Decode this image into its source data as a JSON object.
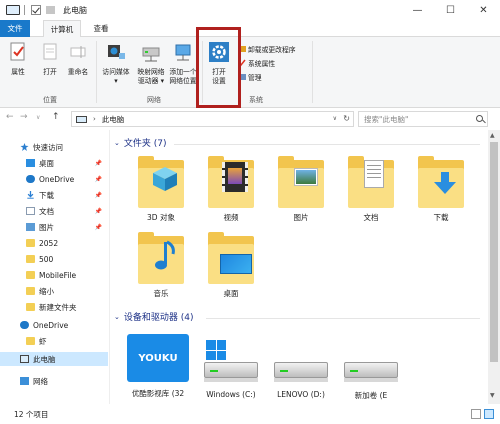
{
  "window": {
    "title": "此电脑",
    "min_label": "—",
    "max_label": "☐",
    "close_label": "✕"
  },
  "tabs": {
    "file": "文件",
    "computer": "计算机",
    "view": "查看"
  },
  "ribbon": {
    "location_group": {
      "label": "位置",
      "properties": "属性",
      "open": "打开",
      "rename": "重命名"
    },
    "network_group": {
      "label": "网络",
      "access_media_l1": "访问媒体",
      "access_media_l2": "▾",
      "map_drive_l1": "映射网络",
      "map_drive_l2": "驱动器 ▾",
      "add_location_l1": "添加一个",
      "add_location_l2": "网络位置"
    },
    "system_group": {
      "label": "系统",
      "open_settings_l1": "打开",
      "open_settings_l2": "设置",
      "uninstall": "卸载或更改程序",
      "system_properties": "系统属性",
      "manage": "管理"
    }
  },
  "navbar": {
    "back": "←",
    "forward": "→",
    "dropdown": "∨",
    "up": "↑",
    "path_sep": "›",
    "path": "此电脑",
    "search_placeholder": "搜索\"此电脑\""
  },
  "sidebar": {
    "items": [
      {
        "label": "快速访问",
        "icon": "star-icon"
      },
      {
        "label": "桌面",
        "icon": "desktop-icon",
        "pinned": true
      },
      {
        "label": "OneDrive",
        "icon": "cloud-icon",
        "pinned": true
      },
      {
        "label": "下载",
        "icon": "download-icon",
        "pinned": true
      },
      {
        "label": "文档",
        "icon": "document-icon",
        "pinned": true
      },
      {
        "label": "图片",
        "icon": "picture-icon",
        "pinned": true
      },
      {
        "label": "2052",
        "icon": "folder-icon"
      },
      {
        "label": "500",
        "icon": "folder-icon"
      },
      {
        "label": "MobileFile",
        "icon": "folder-icon"
      },
      {
        "label": "缩小",
        "icon": "folder-icon"
      },
      {
        "label": "新建文件夹",
        "icon": "folder-icon"
      },
      {
        "label": "OneDrive",
        "icon": "cloud-icon"
      },
      {
        "label": "虾",
        "icon": "folder-icon"
      },
      {
        "label": "此电脑",
        "icon": "computer-icon"
      },
      {
        "label": "网络",
        "icon": "network-icon"
      }
    ],
    "pin_glyph": "📌"
  },
  "content": {
    "folders_header": "文件夹 (7)",
    "folders": [
      {
        "label": "3D 对象",
        "icon": "3d-objects-icon"
      },
      {
        "label": "视频",
        "icon": "videos-icon"
      },
      {
        "label": "图片",
        "icon": "pictures-icon"
      },
      {
        "label": "文档",
        "icon": "documents-icon"
      },
      {
        "label": "下载",
        "icon": "downloads-icon"
      },
      {
        "label": "音乐",
        "icon": "music-icon"
      },
      {
        "label": "桌面",
        "icon": "desktop-folder-icon"
      }
    ],
    "devices_header": "设备和驱动器 (4)",
    "devices": [
      {
        "label": "优酷影视库 (32",
        "icon": "youku-drive-icon",
        "badge": "YOUKU"
      },
      {
        "label": "Windows (C:)",
        "icon": "windows-drive-icon"
      },
      {
        "label": "LENOVO (D:)",
        "icon": "drive-icon"
      },
      {
        "label": "新加卷 (E",
        "icon": "drive-icon"
      }
    ]
  },
  "status": {
    "count": "12 个项目"
  },
  "colors": {
    "accent": "#1979ca",
    "highlight_box": "#b0201e",
    "selected": "#cce8ff",
    "section_header": "#1e3287"
  }
}
